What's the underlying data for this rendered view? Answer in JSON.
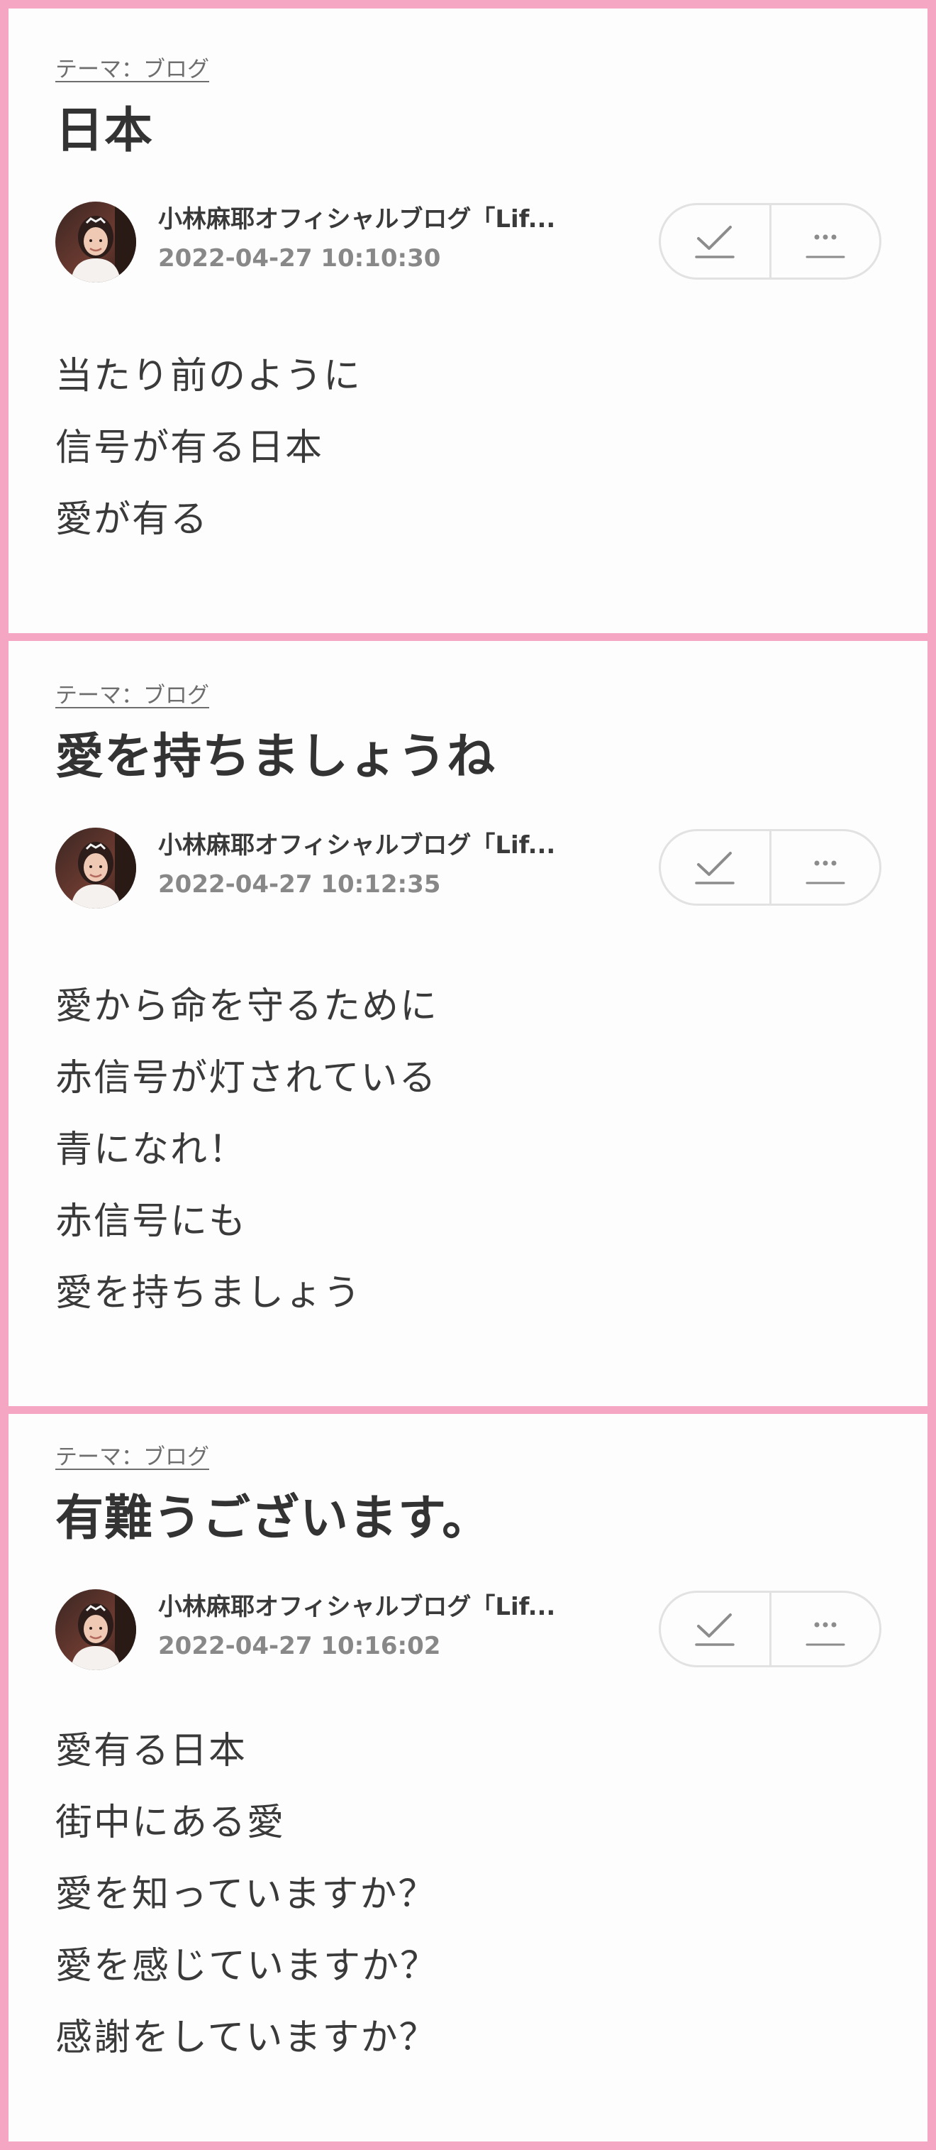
{
  "posts": [
    {
      "theme_label": "テーマ：ブログ",
      "title": "日本",
      "author": "小林麻耶オフィシャルブログ「Lif...",
      "date": "2022-04-27 10:10:30",
      "body": [
        "当たり前のように",
        "信号が有る日本",
        "愛が有る"
      ]
    },
    {
      "theme_label": "テーマ：ブログ",
      "title": "愛を持ちましょうね",
      "author": "小林麻耶オフィシャルブログ「Lif...",
      "date": "2022-04-27 10:12:35",
      "body": [
        "愛から命を守るために",
        "赤信号が灯されている",
        "青になれ！",
        "赤信号にも",
        "愛を持ちましょう"
      ]
    },
    {
      "theme_label": "テーマ：ブログ",
      "title": "有難うございます。",
      "author": "小林麻耶オフィシャルブログ「Lif...",
      "date": "2022-04-27 10:16:02",
      "body": [
        "愛有る日本",
        "街中にある愛",
        "愛を知っていますか？",
        "愛を感じていますか？",
        "感謝をしていますか？"
      ]
    }
  ],
  "icons": {
    "avatar": "author-avatar-photo",
    "reblog": "check-icon",
    "more": "more-icon"
  },
  "colors": {
    "page_background": "#f4a6c3",
    "card_background": "#fdfdfd",
    "title_text": "#333333",
    "meta_text": "#888888",
    "theme_link": "#6e6e6e",
    "button_border": "#e2e2e2"
  }
}
